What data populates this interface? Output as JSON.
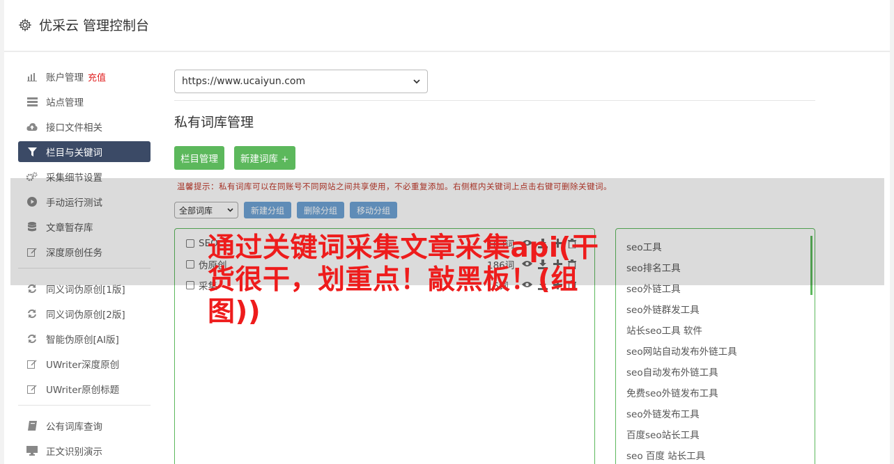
{
  "header": {
    "title": "优采云 管理控制台",
    "icon": "gear-icon"
  },
  "sidebar": {
    "group1": [
      {
        "label": "账户管理",
        "badge": "充值",
        "icon": "bar-chart-icon"
      },
      {
        "label": "站点管理",
        "icon": "server-icon"
      },
      {
        "label": "接口文件相关",
        "icon": "cloud-upload-icon"
      },
      {
        "label": "栏目与关键词",
        "icon": "filter-icon",
        "active": true
      },
      {
        "label": "采集细节设置",
        "icon": "cogs-icon"
      },
      {
        "label": "手动运行测试",
        "icon": "play-circle-icon"
      },
      {
        "label": "文章暂存库",
        "icon": "database-icon"
      },
      {
        "label": "深度原创任务",
        "icon": "edit-icon"
      }
    ],
    "group2": [
      {
        "label": "同义词伪原创[1版]",
        "icon": "refresh-icon"
      },
      {
        "label": "同义词伪原创[2版]",
        "icon": "refresh-icon"
      },
      {
        "label": "智能伪原创[AI版]",
        "icon": "refresh-icon"
      },
      {
        "label": "UWriter深度原创",
        "icon": "edit-icon"
      },
      {
        "label": "UWriter原创标题",
        "icon": "edit-icon"
      }
    ],
    "group3": [
      {
        "label": "公有词库查询",
        "icon": "book-icon"
      },
      {
        "label": "正文识别演示",
        "icon": "monitor-icon"
      }
    ]
  },
  "main": {
    "site_select": "https://www.ucaiyun.com",
    "page_title": "私有词库管理",
    "btn_column": "栏目管理",
    "btn_new_lib": "新建词库 +",
    "tip": "温馨提示：私有词库可以在同账号不同网站之间共享使用，不必重复添加。右侧框内关键词上点击右键可删除关键词。",
    "filter_select": "全部词库",
    "btn_new_group": "新建分组",
    "btn_delete_group": "删除分组",
    "btn_move_group": "移动分组",
    "libraries": [
      {
        "name": "SEO",
        "count": "163词"
      },
      {
        "name": "伪原创",
        "count": "186词"
      },
      {
        "name": "采集",
        "count": "15词"
      }
    ],
    "keywords": [
      "seo工具",
      "seo排名工具",
      "seo外链工具",
      "seo外链群发工具",
      "站长seo工具 软件",
      "seo网站自动发布外链工具",
      "seo自动发布外链工具",
      "免费seo外链发布工具",
      "seo外链发布工具",
      "百度seo站长工具",
      "seo 百度 站长工具"
    ]
  },
  "overlay": {
    "title": "通过关键词采集文章采集api(干货很干，划重点！敲黑板！(组图))",
    "color": "#ee1c1c"
  }
}
